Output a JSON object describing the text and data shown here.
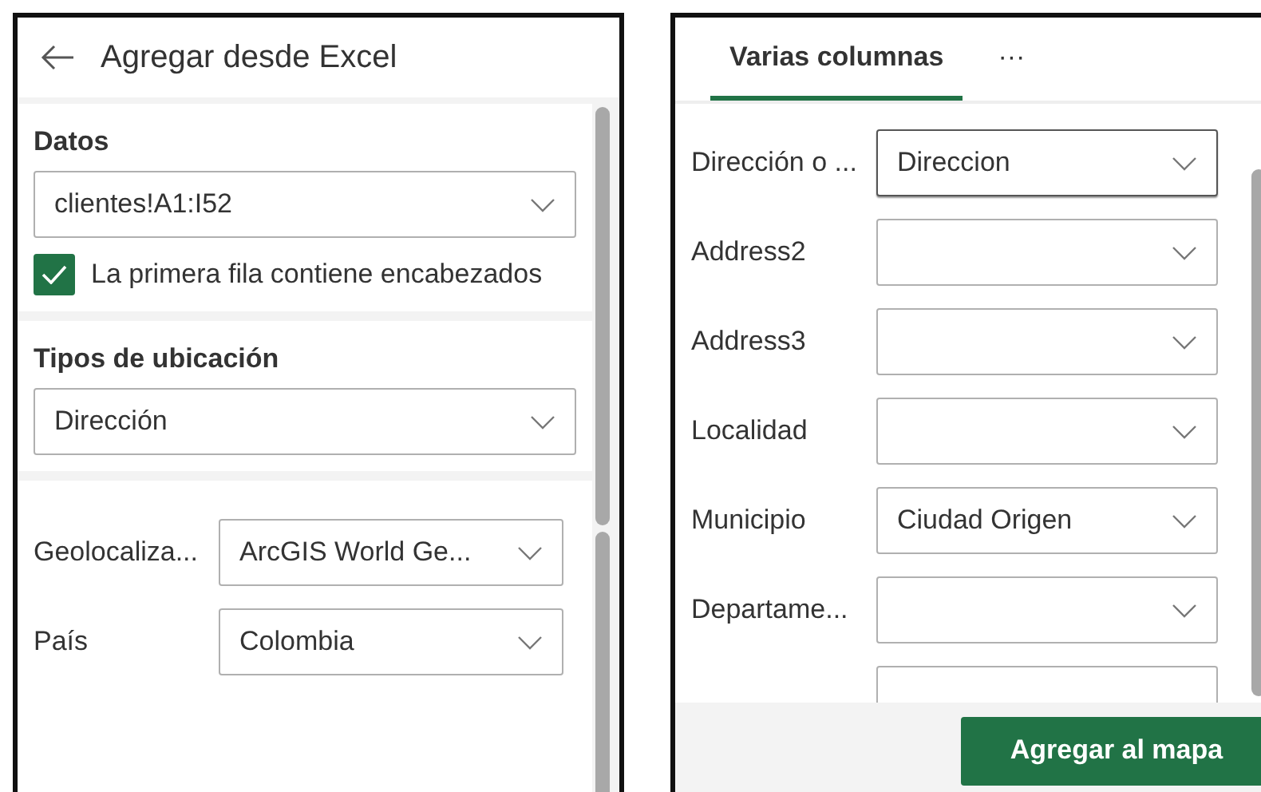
{
  "left_panel": {
    "title": "Agregar desde Excel",
    "data_section": {
      "label": "Datos",
      "range": "clientes!A1:I52",
      "header_checkbox": {
        "label": "La primera fila contiene encabezados",
        "checked": true
      }
    },
    "location_section": {
      "label": "Tipos de ubicación",
      "value": "Dirección"
    },
    "geocoding_rows": [
      {
        "label": "Geolocaliza...",
        "value": "ArcGIS World Ge..."
      },
      {
        "label": "País",
        "value": "Colombia"
      }
    ]
  },
  "right_panel": {
    "tabs": [
      {
        "label": "Varias columnas",
        "selected": true
      },
      {
        "label": "···",
        "selected": false
      }
    ],
    "field_rows": [
      {
        "label": "Dirección o ...",
        "value": "Direccion",
        "focused": true
      },
      {
        "label": "Address2",
        "focused": false
      },
      {
        "label": "Address3",
        "focused": false
      },
      {
        "label": "Localidad",
        "focused": false
      },
      {
        "label": "Municipio",
        "value": "Ciudad Origen",
        "focused": false
      },
      {
        "label": "Departame...",
        "focused": false
      }
    ],
    "add_button": "Agregar al mapa"
  }
}
